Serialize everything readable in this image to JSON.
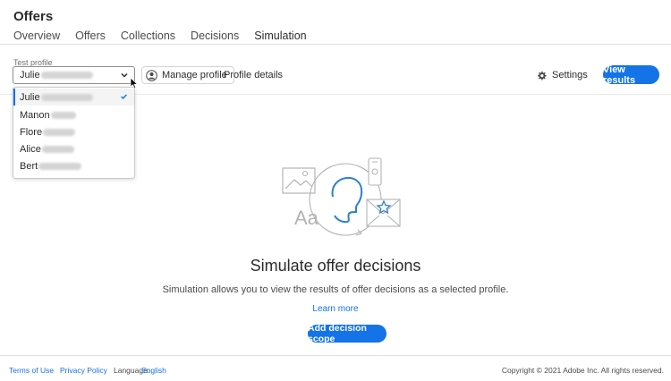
{
  "app": {
    "title": "Offers"
  },
  "tabs": [
    {
      "label": "Overview",
      "active": false
    },
    {
      "label": "Offers",
      "active": false
    },
    {
      "label": "Collections",
      "active": false
    },
    {
      "label": "Decisions",
      "active": false
    },
    {
      "label": "Simulation",
      "active": true
    }
  ],
  "toolbar": {
    "test_profile_label": "Test profile",
    "selected_profile": "Julie",
    "manage_profile": "Manage profile",
    "profile_details": "Profile details",
    "settings": "Settings",
    "view_results": "View results"
  },
  "profile_menu": {
    "items": [
      {
        "name": "Julie",
        "selected": true
      },
      {
        "name": "Manon",
        "selected": false
      },
      {
        "name": "Flore",
        "selected": false
      },
      {
        "name": "Alice",
        "selected": false
      },
      {
        "name": "Bert",
        "selected": false
      }
    ]
  },
  "empty_state": {
    "title": "Simulate offer decisions",
    "description": "Simulation allows you to view the results of offer decisions as a selected profile.",
    "learn_more": "Learn more",
    "add_scope": "Add decision scope",
    "illustration_text": "Aa"
  },
  "footer": {
    "terms": "Terms of Use",
    "privacy": "Privacy Policy",
    "language_label": "Language:",
    "language_value": "English",
    "copyright": "Copyright © 2021 Adobe Inc. All rights reserved."
  },
  "colors": {
    "accent": "#1473e6",
    "illustration_blue": "#2d7fd0",
    "illustration_gray": "#b3b3b3"
  }
}
